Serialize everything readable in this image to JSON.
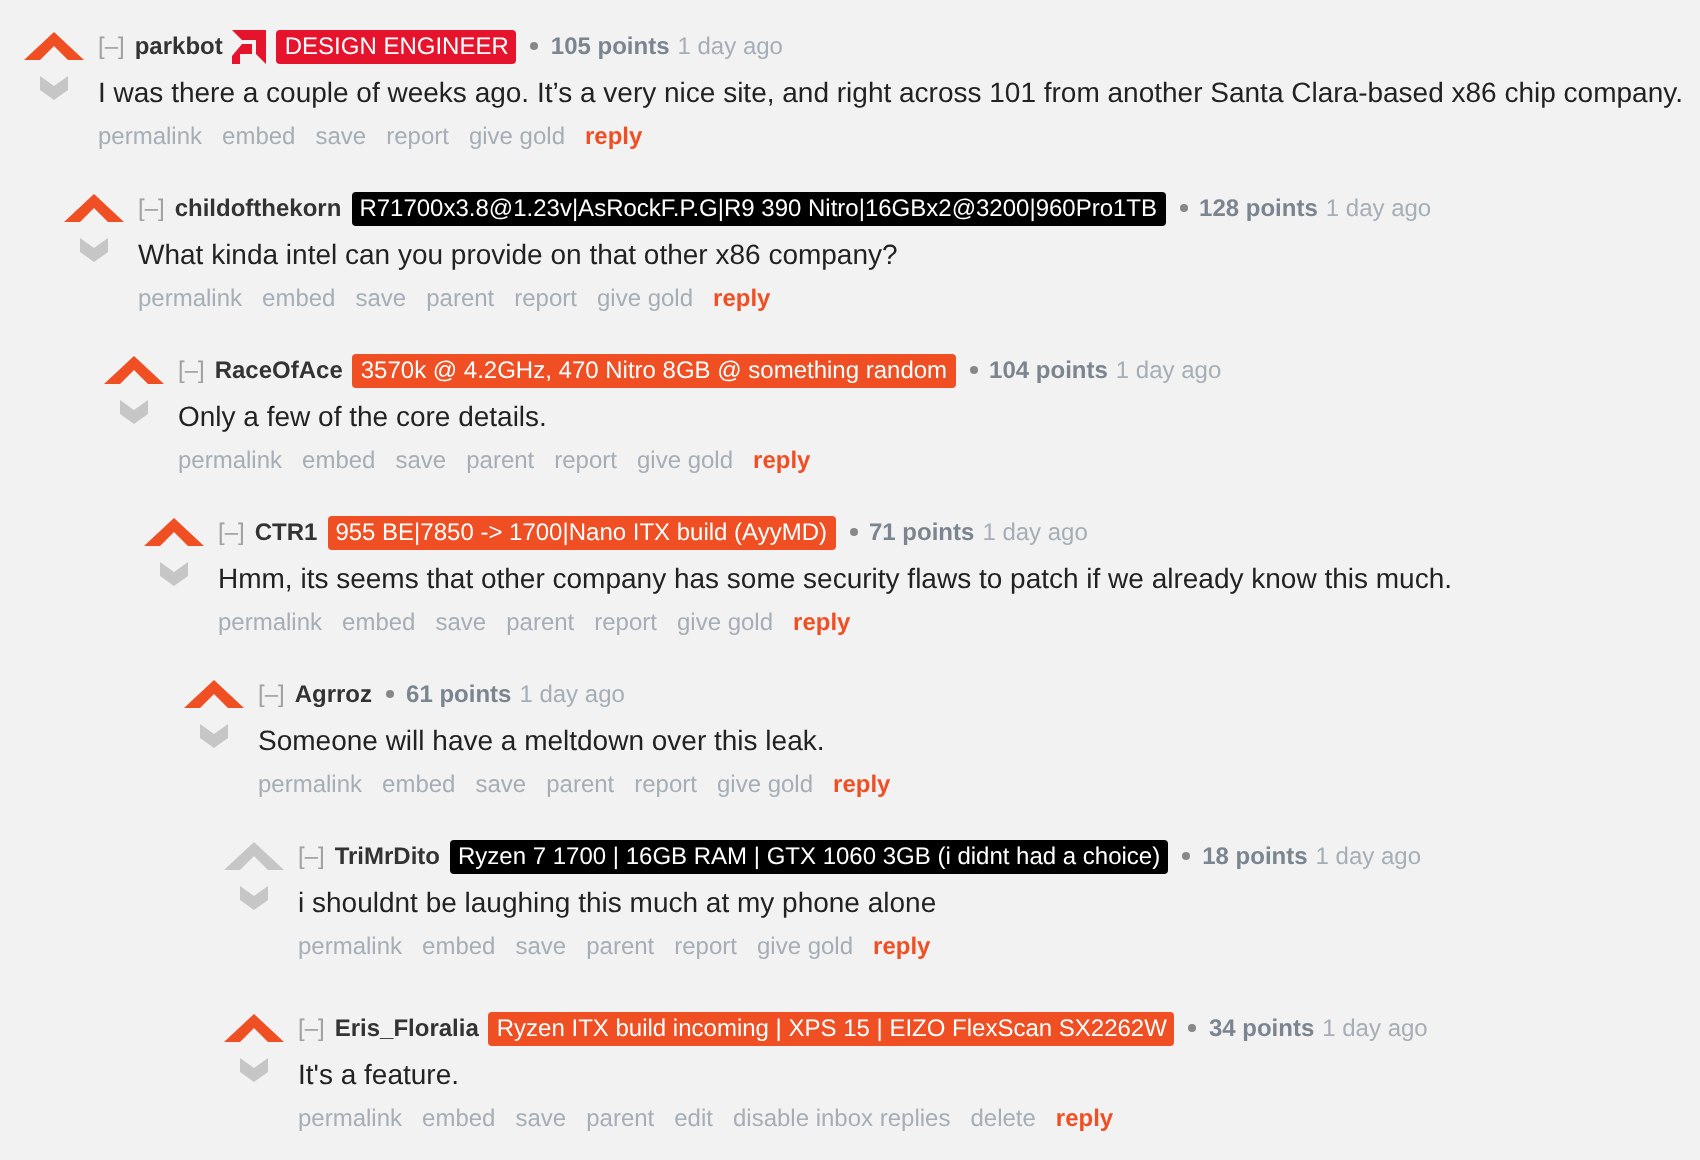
{
  "comments": [
    {
      "author": "parkbot",
      "badge_icon": true,
      "flair": "DESIGN ENGINEER",
      "color": "#e5132c",
      "points": "105 points",
      "time": "1 day ago",
      "upvoted": true,
      "collapse": "[–]",
      "body": "I was there a couple of weeks ago. It’s a very nice site, and right across 101 from another Santa Clara-based x86 chip company.",
      "actions": [
        "permalink",
        "embed",
        "save",
        "report",
        "give gold",
        "reply"
      ],
      "children": [
        {
          "author": "childofthekorn",
          "flair": "R71700x3.8@1.23v|AsRockF.P.G|R9 390 Nitro|16GBx2@3200|960Pro1TB",
          "color": "#000000",
          "points": "128 points",
          "time": "1 day ago",
          "upvoted": true,
          "collapse": "[–]",
          "body": "What kinda intel can you provide on that other x86 company?",
          "actions": [
            "permalink",
            "embed",
            "save",
            "parent",
            "report",
            "give gold",
            "reply"
          ],
          "children": [
            {
              "author": "RaceOfAce",
              "flair": "3570k @ 4.2GHz, 470 Nitro 8GB @ something random",
              "color": "#f04e23",
              "points": "104 points",
              "time": "1 day ago",
              "upvoted": true,
              "collapse": "[–]",
              "body": "Only a few of the core details.",
              "actions": [
                "permalink",
                "embed",
                "save",
                "parent",
                "report",
                "give gold",
                "reply"
              ],
              "children": [
                {
                  "author": "CTR1",
                  "flair": "955 BE|7850 -> 1700|Nano ITX build (AyyMD)",
                  "color": "#f04e23",
                  "points": "71 points",
                  "time": "1 day ago",
                  "upvoted": true,
                  "collapse": "[–]",
                  "body": "Hmm, its seems that other company has some security flaws to patch if we already know this much.",
                  "actions": [
                    "permalink",
                    "embed",
                    "save",
                    "parent",
                    "report",
                    "give gold",
                    "reply"
                  ],
                  "children": [
                    {
                      "author": "Agrroz",
                      "points": "61 points",
                      "time": "1 day ago",
                      "upvoted": true,
                      "collapse": "[–]",
                      "body": "Someone will have a meltdown over this leak.",
                      "actions": [
                        "permalink",
                        "embed",
                        "save",
                        "parent",
                        "report",
                        "give gold",
                        "reply"
                      ],
                      "children": [
                        {
                          "author": "TriMrDito",
                          "flair": "Ryzen 7 1700 | 16GB RAM | GTX 1060 3GB (i didnt had a choice)",
                          "color": "#000000",
                          "points": "18 points",
                          "time": "1 day ago",
                          "upvoted": false,
                          "collapse": "[–]",
                          "body": "i shouldnt be laughing this much at my phone alone",
                          "actions": [
                            "permalink",
                            "embed",
                            "save",
                            "parent",
                            "report",
                            "give gold",
                            "reply"
                          ]
                        },
                        {
                          "author": "Eris_Floralia",
                          "flair": "Ryzen ITX build incoming | XPS 15 | EIZO FlexScan SX2262W",
                          "color": "#f04e23",
                          "points": "34 points",
                          "time": "1 day ago",
                          "upvoted": true,
                          "collapse": "[–]",
                          "body": "It's a feature.",
                          "actions": [
                            "permalink",
                            "embed",
                            "save",
                            "parent",
                            "edit",
                            "disable inbox replies",
                            "delete",
                            "reply"
                          ]
                        }
                      ]
                    }
                  ]
                }
              ]
            }
          ]
        }
      ]
    }
  ]
}
